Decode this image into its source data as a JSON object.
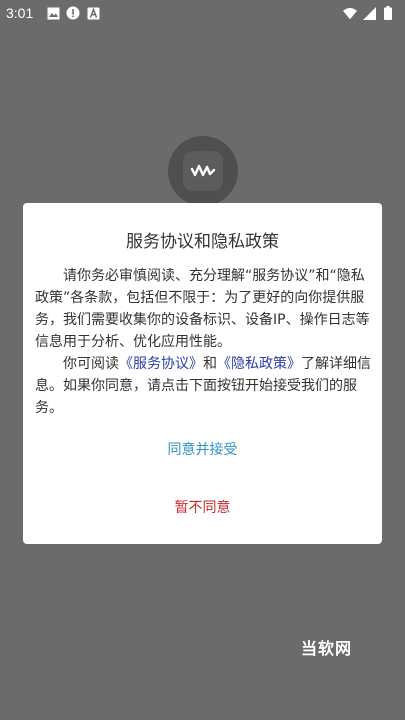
{
  "status_bar": {
    "time": "3:01",
    "left_icons": [
      "image-icon",
      "alert-icon",
      "a-icon"
    ],
    "right_icons": [
      "wifi-icon",
      "signal-icon",
      "battery-icon"
    ]
  },
  "app": {
    "logo_icon": "waveform-icon"
  },
  "dialog": {
    "title": "服务协议和隐私政策",
    "paragraph1": "请你务必审慎阅读、充分理解“服务协议”和“隐私政策”各条款，包括但不限于：为了更好的向你提供服务，我们需要收集你的设备标识、设备IP、操作日志等信息用于分析、优化应用性能。",
    "paragraph2_prefix": "你可阅读",
    "link_service": "《服务协议》",
    "paragraph2_and": "和",
    "link_privacy": "《隐私政策》",
    "paragraph2_suffix": "了解详细信息。如果你同意，请点击下面按钮开始接受我们的服务。",
    "accept_label": "同意并接受",
    "decline_label": "暂不同意",
    "colors": {
      "accept": "#2f93c6",
      "decline": "#c62c2c",
      "link": "#2b3fa6"
    }
  },
  "watermark": "当软网"
}
